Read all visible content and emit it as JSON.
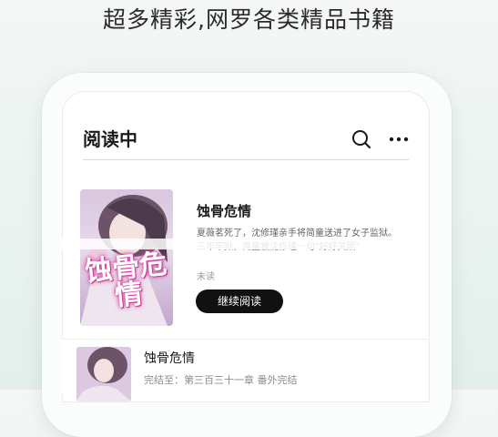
{
  "headline": "超多精彩,网罗各类精品书籍",
  "screen": {
    "title": "阅读中",
    "search_icon": "search-icon",
    "more_icon": "more-dots-icon"
  },
  "featured": {
    "cover_text": "蚀骨危情",
    "title": "蚀骨危情",
    "description": "夏薇茗死了，沈修瑾亲手将简童送进了女子监狱。三年牢狱，简童被沈修瑾一句\"好好关照\"",
    "status": "未读",
    "continue_label": "继续阅读"
  },
  "list": [
    {
      "title": "蚀骨危情",
      "progress": "完结至：第三百三十一章 番外完结"
    }
  ],
  "colors": {
    "accent": "#111111",
    "cover_pink": "#e04aa6"
  }
}
